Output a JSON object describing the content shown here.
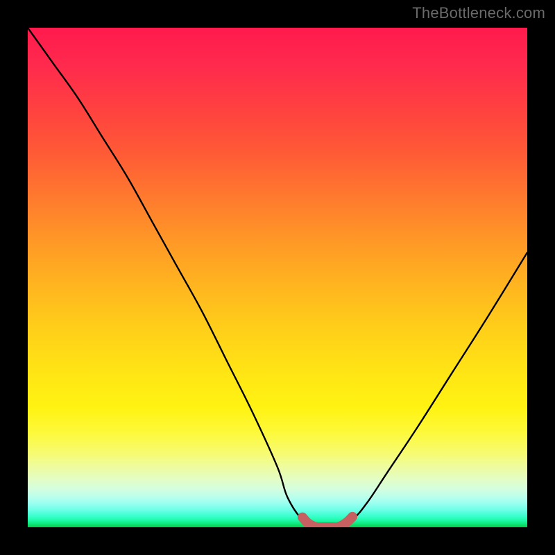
{
  "watermark": "TheBottleneck.com",
  "chart_data": {
    "type": "line",
    "title": "",
    "xlabel": "",
    "ylabel": "",
    "xlim": [
      0,
      100
    ],
    "ylim": [
      0,
      100
    ],
    "grid": false,
    "background_gradient": {
      "orientation": "vertical",
      "stops": [
        {
          "pos": 0.0,
          "color": "#ff1a4d"
        },
        {
          "pos": 0.3,
          "color": "#ff7030"
        },
        {
          "pos": 0.6,
          "color": "#ffd018"
        },
        {
          "pos": 0.8,
          "color": "#fdf93a"
        },
        {
          "pos": 0.92,
          "color": "#d8fed8"
        },
        {
          "pos": 1.0,
          "color": "#0acc52"
        }
      ]
    },
    "series": [
      {
        "name": "bottleneck-curve",
        "color": "#000000",
        "x": [
          0,
          5,
          10,
          15,
          20,
          25,
          30,
          35,
          40,
          45,
          50,
          52,
          55,
          58,
          62,
          65,
          68,
          72,
          78,
          85,
          92,
          100
        ],
        "y": [
          100,
          93,
          86,
          78,
          70,
          61,
          52,
          43,
          33,
          23,
          12,
          6,
          1.5,
          0,
          0,
          1.5,
          5,
          11,
          20,
          31,
          42,
          55
        ]
      },
      {
        "name": "optimal-marker",
        "color": "#c76060",
        "style": "thick-segment",
        "x": [
          55,
          56,
          57,
          58,
          59,
          60,
          61,
          62,
          63,
          64,
          65
        ],
        "y": [
          2.0,
          0.9,
          0.3,
          0.0,
          0.0,
          0.0,
          0.0,
          0.0,
          0.4,
          1.1,
          2.1
        ]
      }
    ],
    "annotations": [
      {
        "text": "TheBottleneck.com",
        "position": "top-right",
        "color": "#6a6a6a"
      }
    ]
  }
}
